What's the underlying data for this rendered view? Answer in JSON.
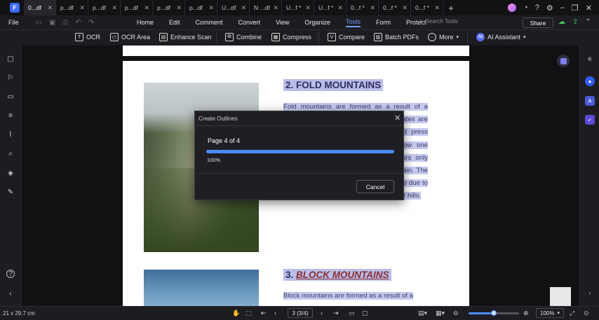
{
  "tabs": [
    {
      "label": "0...df",
      "active": true
    },
    {
      "label": "p...df"
    },
    {
      "label": "p...df"
    },
    {
      "label": "p...df"
    },
    {
      "label": "p...df"
    },
    {
      "label": "p...df"
    },
    {
      "label": "U...df"
    },
    {
      "label": "N ...df"
    },
    {
      "label": "U...f *"
    },
    {
      "label": "U...f *"
    },
    {
      "label": "0...f *"
    },
    {
      "label": "0...f *"
    },
    {
      "label": "0...f *"
    }
  ],
  "menubar": {
    "file": "File",
    "items": [
      "Home",
      "Edit",
      "Comment",
      "Convert",
      "View",
      "Organize",
      "Tools",
      "Form",
      "Protect"
    ],
    "active": "Tools",
    "search_placeholder": "Search Tools",
    "share": "Share"
  },
  "toolbar": {
    "ocr": "OCR",
    "ocr_area": "OCR Area",
    "enhance_scan": "Enhance Scan",
    "combine": "Combine",
    "compress": "Compress",
    "compare": "Compare",
    "batch_pdfs": "Batch PDFs",
    "more": "More",
    "ai_assistant": "AI Assistant"
  },
  "document": {
    "heading1": "2. FOLD MOUNTAINS",
    "para1": "Fold mountains are formed as a result of a collision of two tectonic plates. The plates are known as continental plates shift and press against the mantle, one another below one surface, the mantle of the folds occurs only when the formation forms a fold mountain. The other materials remain above the surface due to its density usually resulting in plateaus or hills.",
    "heading2_num": "3.",
    "heading2_text": "BLOCK MOUNTAINS",
    "para2": "Block mountains are formed as a result of a"
  },
  "dialog": {
    "title": "Create Outlines",
    "page_status": "Page 4 of 4",
    "progress": 1.0,
    "percent": "100%",
    "cancel": "Cancel"
  },
  "statusbar": {
    "page_size": "21 x 29.7 cm",
    "page_indicator": "3 (3/4)",
    "zoom": "100%",
    "zoom_fraction": 0.5
  },
  "colors": {
    "accent": "#4a8cff",
    "highlight": "#c6c9ef",
    "heading_highlight": "#b9bdea"
  }
}
